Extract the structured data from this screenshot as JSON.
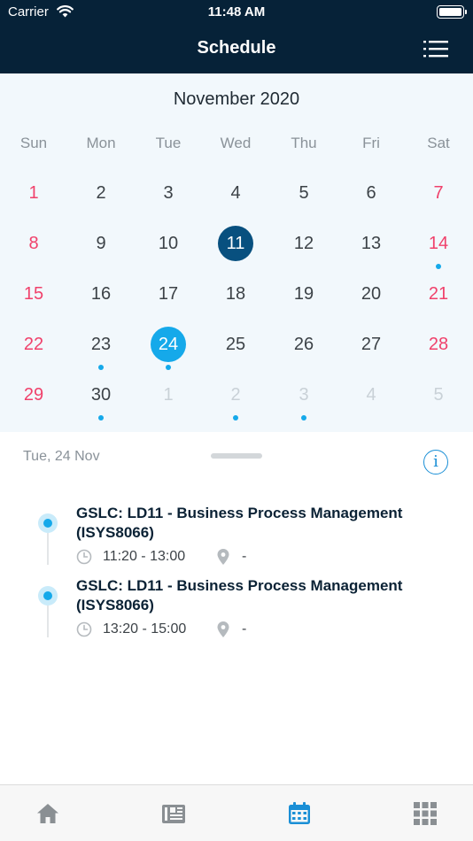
{
  "status_bar": {
    "carrier": "Carrier",
    "time": "11:48 AM"
  },
  "nav": {
    "title": "Schedule",
    "menu_icon": "list-icon"
  },
  "calendar": {
    "month_label": "November 2020",
    "weekdays": [
      "Sun",
      "Mon",
      "Tue",
      "Wed",
      "Thu",
      "Fri",
      "Sat"
    ],
    "weeks": [
      [
        "1",
        "2",
        "3",
        "4",
        "5",
        "6",
        "7"
      ],
      [
        "8",
        "9",
        "10",
        "11",
        "12",
        "13",
        "14"
      ],
      [
        "15",
        "16",
        "17",
        "18",
        "19",
        "20",
        "21"
      ],
      [
        "22",
        "23",
        "24",
        "25",
        "26",
        "27",
        "28"
      ],
      [
        "29",
        "30",
        "1",
        "2",
        "3",
        "4",
        "5"
      ]
    ],
    "today": "11",
    "selected": "24",
    "colors": {
      "weekend": "#f0416b",
      "today": "#08507f",
      "selected": "#15a9ea",
      "dot": "#15a9ea"
    }
  },
  "agenda": {
    "selected_date": "Tue, 24 Nov",
    "info_icon": "info-icon",
    "events": [
      {
        "title": "GSLC: LD11 - Business Process Management (ISYS8066)",
        "time": "11:20 - 13:00",
        "location": "-"
      },
      {
        "title": "GSLC: LD11 - Business Process Management (ISYS8066)",
        "time": "13:20 - 15:00",
        "location": "-"
      }
    ]
  },
  "tab_bar": {
    "tabs": [
      {
        "icon": "home-icon",
        "active": false
      },
      {
        "icon": "newspaper-icon",
        "active": false
      },
      {
        "icon": "calendar-icon",
        "active": true
      },
      {
        "icon": "grid-icon",
        "active": false
      }
    ],
    "colors": {
      "active": "#1a8fd6",
      "inactive": "#8a8f93"
    }
  }
}
